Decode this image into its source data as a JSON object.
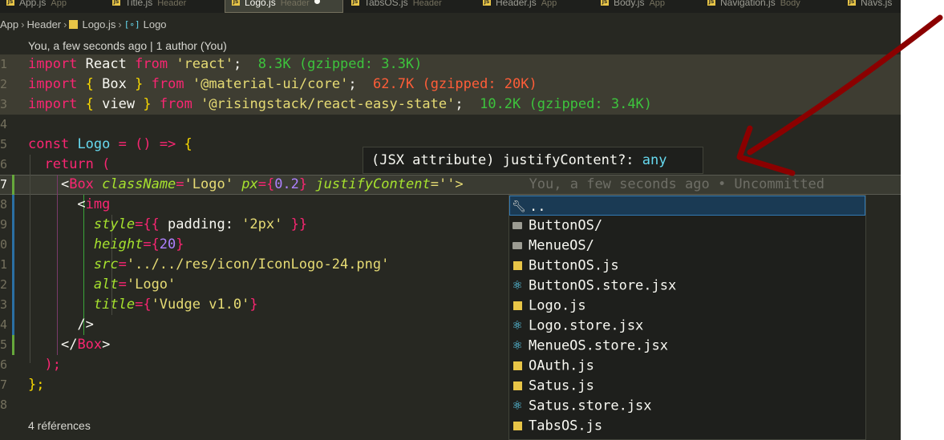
{
  "tabs": [
    {
      "name": "App.js",
      "desc": "App"
    },
    {
      "name": "Title.js",
      "desc": "Header"
    },
    {
      "name": "Logo.js",
      "desc": "Header",
      "active": true
    },
    {
      "name": "TabsOS.js",
      "desc": "Header"
    },
    {
      "name": "Header.js",
      "desc": "App"
    },
    {
      "name": "Body.js",
      "desc": "App"
    },
    {
      "name": "Navigation.js",
      "desc": "Body"
    },
    {
      "name": "Navs.js",
      "desc": ""
    }
  ],
  "breadcrumb": {
    "items": [
      "App",
      "Header",
      "Logo.js",
      "Logo"
    ],
    "symbol_icon": "[∘]"
  },
  "codelens": {
    "blame_top": "You, a few seconds ago | 1 author (You)",
    "references": "4 références"
  },
  "code": {
    "line_numbers": [
      "1",
      "2",
      "3",
      "4",
      "5",
      "6",
      "7",
      "8",
      "9",
      "0",
      "1",
      "2",
      "3",
      "4",
      "5",
      "6",
      "7",
      "8"
    ],
    "l1": {
      "import": "import",
      "name": "React",
      "from": "from",
      "module": "'react'",
      "semi": ";",
      "size": "8.3K (gzipped: 3.3K)"
    },
    "l2": {
      "import": "import",
      "open": "{",
      "name": "Box",
      "close": "}",
      "from": "from",
      "module": "'@material-ui/core'",
      "semi": ";",
      "size": "62.7K (gzipped: 20K)"
    },
    "l3": {
      "import": "import",
      "open": "{",
      "name": "view",
      "close": "}",
      "from": "from",
      "module": "'@risingstack/react-easy-state'",
      "semi": ";",
      "size": "10.2K (gzipped: 3.4K)"
    },
    "l5": {
      "const": "const",
      "name": "Logo",
      "rest": "= () =>",
      "brace": "{"
    },
    "l6": {
      "ret": "return",
      "paren": "("
    },
    "l7": {
      "lt": "<",
      "tag": "Box",
      "a1": "className",
      "v1": "'Logo'",
      "a2": "px",
      "v2o": "={",
      "v2": "0.2",
      "v2c": "}",
      "a3": "justifyContent",
      "v3": "='",
      "cursor": "'>",
      "blame": "You, a few seconds ago • Uncommitted"
    },
    "l8": {
      "lt": "<",
      "tag": "img"
    },
    "l9": {
      "attr": "style",
      "eq": "={{",
      "key": "padding:",
      "val": "'2px'",
      "close": "}}"
    },
    "l10": {
      "attr": "height",
      "eq": "={",
      "val": "20",
      "close": "}"
    },
    "l11": {
      "attr": "src",
      "eq": "=",
      "val": "'../../res/icon/IconLogo-24.png'"
    },
    "l12": {
      "attr": "alt",
      "eq": "=",
      "val": "'Logo'"
    },
    "l13": {
      "attr": "title",
      "eq": "={",
      "val": "'Vudge v1.0'",
      "close": "}"
    },
    "l14": {
      "text": "/>"
    },
    "l15": {
      "lt": "</",
      "tag": "Box",
      "gt": ">"
    },
    "l16": {
      "text": ");"
    },
    "l17": {
      "text": "};"
    }
  },
  "hover": {
    "prefix": "(JSX attribute) ",
    "name": "justifyContent",
    "suffix": "?: ",
    "type": "any"
  },
  "suggestions": [
    {
      "label": "..",
      "icon": "wrench-icon",
      "selected": true
    },
    {
      "label": "ButtonOS/",
      "icon": "folder-icon"
    },
    {
      "label": "MenueOS/",
      "icon": "folder-icon"
    },
    {
      "label": "ButtonOS.js",
      "icon": "js-file-icon"
    },
    {
      "label": "ButtonOS.store.jsx",
      "icon": "react-file-icon"
    },
    {
      "label": "Logo.js",
      "icon": "js-file-icon"
    },
    {
      "label": "Logo.store.jsx",
      "icon": "react-file-icon"
    },
    {
      "label": "MenueOS.store.jsx",
      "icon": "react-file-icon"
    },
    {
      "label": "OAuth.js",
      "icon": "js-file-icon"
    },
    {
      "label": "Satus.js",
      "icon": "js-file-icon"
    },
    {
      "label": "Satus.store.jsx",
      "icon": "react-file-icon"
    },
    {
      "label": "TabsOS.js",
      "icon": "js-file-icon"
    }
  ],
  "colors": {
    "editor_bg": "#272822",
    "annotation_arrow": "#8b0000",
    "selected_suggestion": "#1a3a54"
  }
}
